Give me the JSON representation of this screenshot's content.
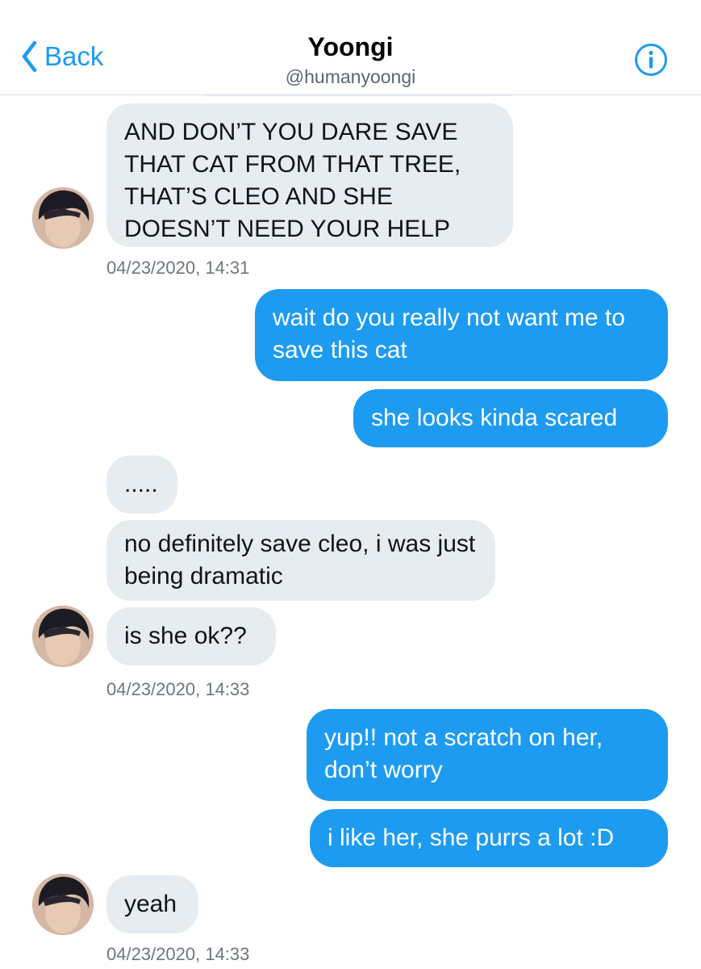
{
  "header": {
    "back_label": "Back",
    "title": "Yoongi",
    "handle": "@humanyoongi"
  },
  "colors": {
    "accent": "#1d9bf0",
    "incoming_bubble": "#e6ecf0",
    "outgoing_bubble": "#1d9bf0"
  },
  "messages": [
    {
      "from": "them",
      "text": "AND DON’T YOU DARE SAVE THAT CAT FROM THAT TREE, THAT’S CLEO AND SHE DOESN’T NEED YOUR HELP"
    },
    {
      "from": "meta",
      "text": "04/23/2020, 14:31"
    },
    {
      "from": "me",
      "text": "wait do you really not want me to save this cat"
    },
    {
      "from": "me",
      "text": "she looks kinda scared"
    },
    {
      "from": "them",
      "text": "....."
    },
    {
      "from": "them",
      "text": "no definitely save cleo, i was just being dramatic"
    },
    {
      "from": "them",
      "text": "is she ok??"
    },
    {
      "from": "meta",
      "text": "04/23/2020, 14:33"
    },
    {
      "from": "me",
      "text": "yup!! not a scratch on her, don’t worry"
    },
    {
      "from": "me",
      "text": "i like her, she purrs a lot :D"
    },
    {
      "from": "them",
      "text": "yeah"
    },
    {
      "from": "meta",
      "text": "04/23/2020, 14:33"
    }
  ]
}
